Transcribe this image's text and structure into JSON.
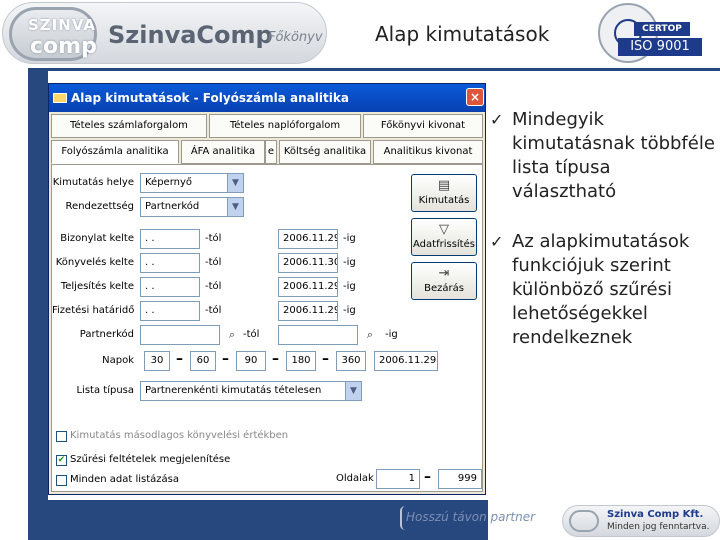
{
  "header": {
    "logo_top": "SZINVA",
    "logo_bottom": "comp",
    "brand": "SzinvaComp",
    "brand_sub": "Főkönyv",
    "page_title": "Alap kimutatások",
    "certop": "CERTOP",
    "iso": "ISO 9001"
  },
  "window": {
    "title": "Alap kimutatások - Folyószámla analitika",
    "close": "×",
    "tabs_row1": [
      "Tételes számlaforgalom",
      "Tételes naplóforgalom",
      "Főkönyvi kivonat"
    ],
    "tabs_row2": [
      "Folyószámla analitika",
      "ÁFA analitika",
      "e",
      "Költség analitika",
      "Analitikus kivonat"
    ],
    "form": {
      "kimutatas_helye_label": "Kimutatás helye",
      "kimutatas_helye_value": "Képernyő",
      "rendezettseg_label": "Rendezettség",
      "rendezettseg_value": "Partnerkód",
      "date_rows": [
        {
          "label": "Bizonylat kelte",
          "from": ". .",
          "to": "2006.11.29"
        },
        {
          "label": "Könyvelés kelte",
          "from": ". .",
          "to": "2006.11.30"
        },
        {
          "label": "Teljesítés kelte",
          "from": ". .",
          "to": "2006.11.29"
        },
        {
          "label": "Fizetési határidő",
          "from": ". .",
          "to": "2006.11.29"
        }
      ],
      "from_suffix": "-tól",
      "to_suffix": "-ig",
      "partnerkod_label": "Partnerkód",
      "partner_from_suffix": "-tól",
      "partner_to_suffix": "-ig",
      "napok_label": "Napok",
      "napok": [
        "30",
        "60",
        "90",
        "180",
        "360"
      ],
      "napok_date": "2006.11.29",
      "lista_tipusa_label": "Lista típusa",
      "lista_tipusa_value": "Partnerenkénti kimutatás tételesen",
      "checkboxes": [
        {
          "label": "Kimutatás másodlagos könyvelési értékben",
          "checked": false
        },
        {
          "label": "Szűrési feltételek megjelenítése",
          "checked": true
        },
        {
          "label": "Minden adat listázása",
          "checked": false
        }
      ],
      "check_mark": "✔",
      "oldalak_label": "Oldalak",
      "oldal_from": "1",
      "oldal_to": "999"
    },
    "buttons": {
      "kimutatas": "Kimutatás",
      "adatfrissites": "Adatfrissítés",
      "bezaras": "Bezárás"
    }
  },
  "bullets": [
    "Mindegyik kimutatásnak többféle lista típusa választható",
    "Az alapkimutatások funkciójuk szerint különböző szűrési lehetőségekkel rendelkeznek"
  ],
  "check_glyph": "✓",
  "footer": {
    "slogan": "Hosszú távon partner",
    "company": "Szinva Comp Kft.",
    "tagline": "Minden jog fenntartva."
  }
}
